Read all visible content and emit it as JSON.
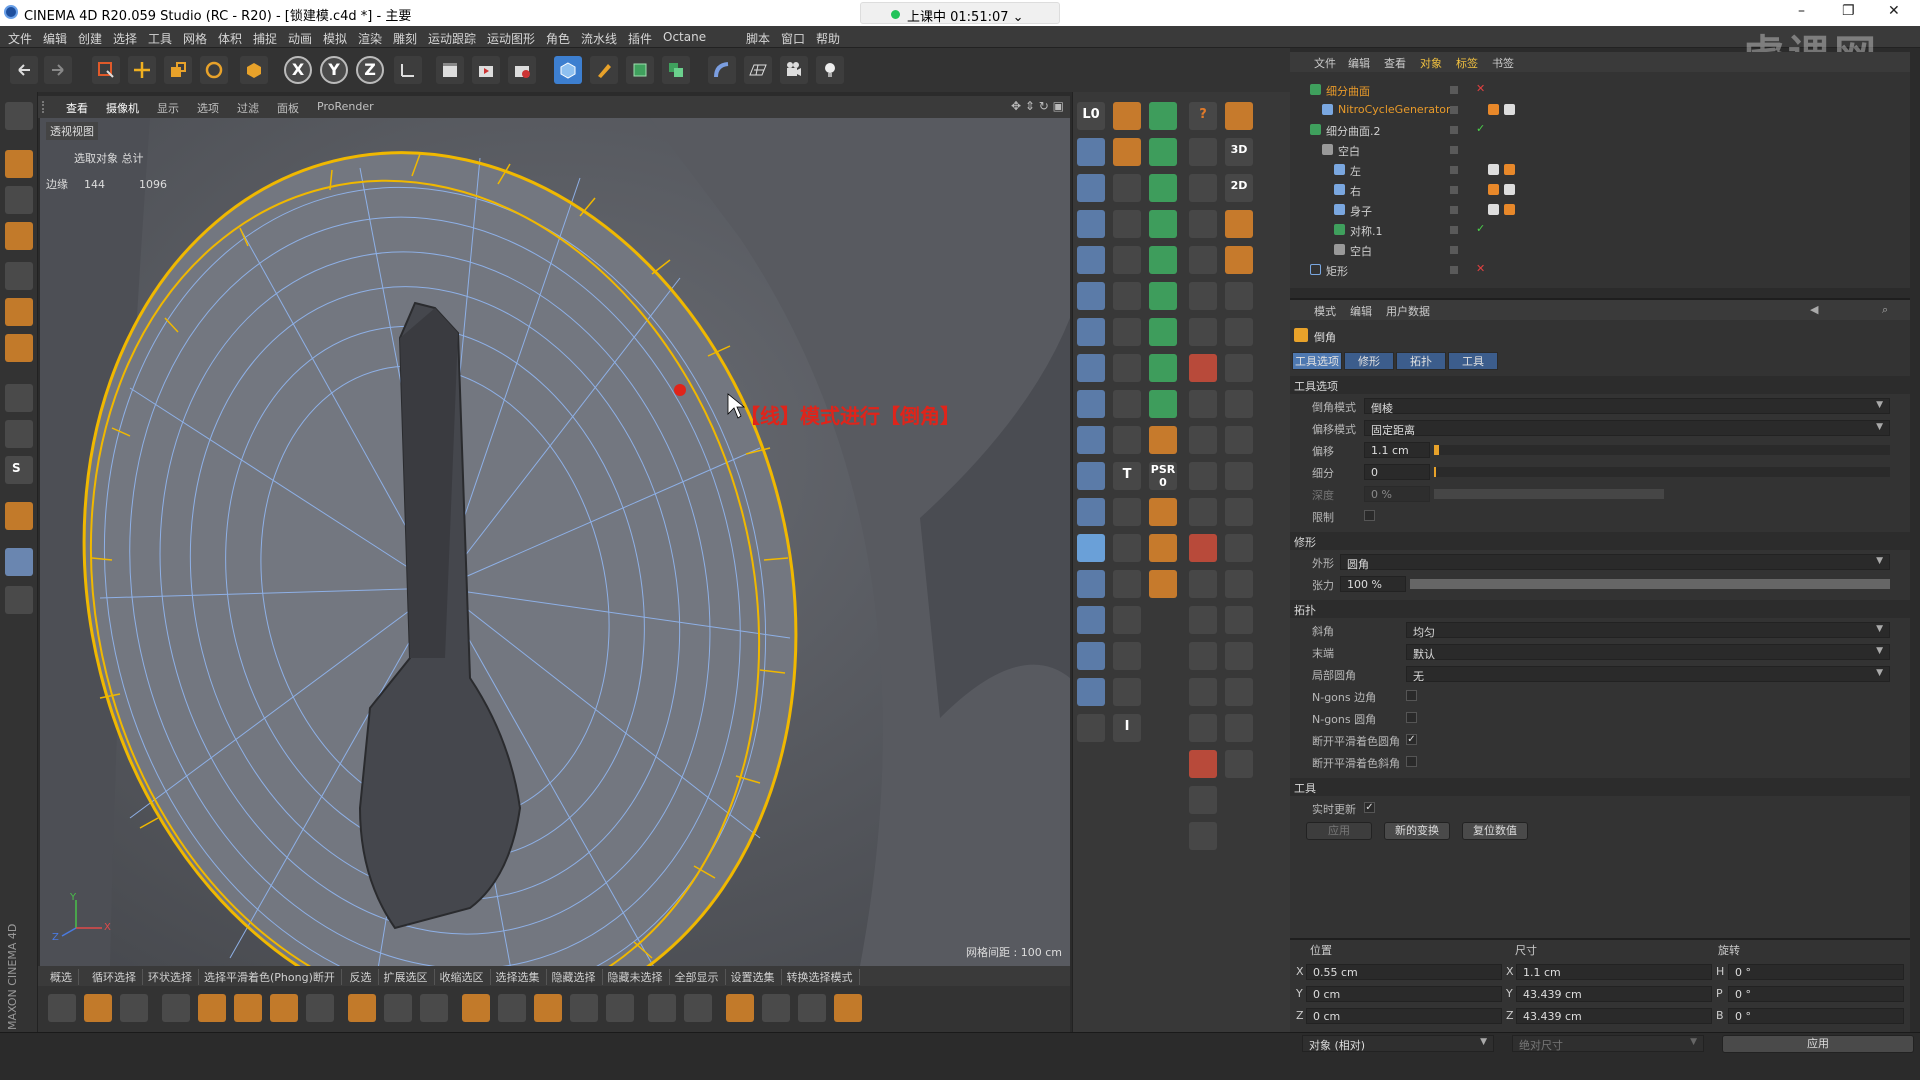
{
  "window": {
    "title": "CINEMA 4D R20.059 Studio (RC - R20) - [锁建模.c4d *] - 主要",
    "lesson_status": "上课中 01:51:07",
    "watermark": "虎课网",
    "minimize": "–",
    "restore": "❐",
    "close": "✕"
  },
  "menu": [
    "文件",
    "编辑",
    "创建",
    "选择",
    "工具",
    "网格",
    "体积",
    "捕捉",
    "动画",
    "模拟",
    "渲染",
    "雕刻",
    "运动跟踪",
    "运动图形",
    "角色",
    "流水线",
    "插件",
    "Octane",
    "脚本",
    "窗口",
    "帮助"
  ],
  "toolbar": {
    "axis_x": "X",
    "axis_y": "Y",
    "axis_z": "Z"
  },
  "viewport": {
    "menu": [
      "查看",
      "摄像机",
      "显示",
      "选项",
      "过滤",
      "面板",
      "ProRender"
    ],
    "label": "透视视图",
    "stats_header": "选取对象  总计",
    "stats_row_label": "边缘",
    "stats_selected": "144",
    "stats_total": "1096",
    "annotation": "【线】模式进行【倒角】",
    "grid_info": "网格间距 : 100 cm",
    "axis_x": "X",
    "axis_y": "Y",
    "axis_z": "Z"
  },
  "bottom_bar": [
    "循环选择",
    "环状选择",
    "选择平滑着色(Phong)断开",
    "反选",
    "扩展选区",
    "收缩选区",
    "选择选集",
    "隐藏选择",
    "隐藏未选择",
    "全部显示",
    "设置选集",
    "转换选择模式"
  ],
  "bottom_bar_first": "概选",
  "palette": {
    "psr": "PSR",
    "psr_value": "0",
    "label_3d": "3D",
    "label_2d": "2D",
    "text_tool": "T",
    "snap": "S",
    "spline_i": "I"
  },
  "object_manager": {
    "tabs": [
      "文件",
      "编辑",
      "查看",
      "对象",
      "标签",
      "书签"
    ],
    "objects": [
      {
        "name": "细分曲面",
        "color": "#e89a2a",
        "status": "✕"
      },
      {
        "name": "NitroCycleGenerator",
        "color": "#e89a2a",
        "status": ""
      },
      {
        "name": "细分曲面.2",
        "color": "#cfcfcf",
        "status": "✓"
      },
      {
        "name": "空白",
        "color": "#cfcfcf",
        "status": ""
      },
      {
        "name": "左",
        "color": "#cfcfcf",
        "status": ""
      },
      {
        "name": "右",
        "color": "#cfcfcf",
        "status": ""
      },
      {
        "name": "身子",
        "color": "#cfcfcf",
        "status": ""
      },
      {
        "name": "对称.1",
        "color": "#cfcfcf",
        "status": "✓"
      },
      {
        "name": "空白",
        "color": "#cfcfcf",
        "status": ""
      },
      {
        "name": "矩形",
        "color": "#cfcfcf",
        "status": "✕"
      }
    ]
  },
  "attributes": {
    "menu": [
      "模式",
      "编辑",
      "用户数据"
    ],
    "tool_name": "倒角",
    "tabs": [
      "工具选项",
      "修形",
      "拓扑",
      "工具"
    ],
    "sec_tool_options": "工具选项",
    "bevel_mode_label": "倒角模式",
    "bevel_mode": "倒棱",
    "offset_mode_label": "偏移模式",
    "offset_mode": "固定距离",
    "offset_label": "偏移",
    "offset": "1.1 cm",
    "subdivision_label": "细分",
    "subdivision": "0",
    "depth_label": "深度",
    "depth": "0 %",
    "limit_label": "限制",
    "sec_shaping": "修形",
    "shape_label": "外形",
    "shape": "圆角",
    "tension_label": "张力",
    "tension": "100 %",
    "sec_topology": "拓扑",
    "miter_label": "斜角",
    "miter": "均匀",
    "end_label": "末端",
    "end": "默认",
    "partial_label": "局部圆角",
    "partial": "无",
    "ngons_corner": "N-gons 边角",
    "ngons_round": "N-gons 圆角",
    "break_phong": "断开平滑着色圆角",
    "break_phong_miter": "断开平滑着色斜角",
    "sec_tool": "工具",
    "realtime": "实时更新",
    "apply": "应用",
    "new_transform": "新的变换",
    "reset": "复位数值",
    "check": "✓"
  },
  "coordinates": {
    "headers": [
      "位置",
      "尺寸",
      "旋转"
    ],
    "rows": [
      {
        "a": "X",
        "pos": "0.55 cm",
        "s": "X",
        "size": "1.1 cm",
        "r": "H",
        "rot": "0 °"
      },
      {
        "a": "Y",
        "pos": "0 cm",
        "s": "Y",
        "size": "43.439 cm",
        "r": "P",
        "rot": "0 °"
      },
      {
        "a": "Z",
        "pos": "0 cm",
        "s": "Z",
        "size": "43.439 cm",
        "r": "B",
        "rot": "0 °"
      }
    ],
    "mode": "对象 (相对)",
    "size_mode": "绝对尺寸",
    "apply": "应用"
  },
  "brand": "MAXON CINEMA 4D",
  "colors": {
    "accent": "#3c5d8c",
    "selection_edge": "#f0b800",
    "annotation": "#e0241a",
    "mesh_wire": "#8eb0e6"
  }
}
